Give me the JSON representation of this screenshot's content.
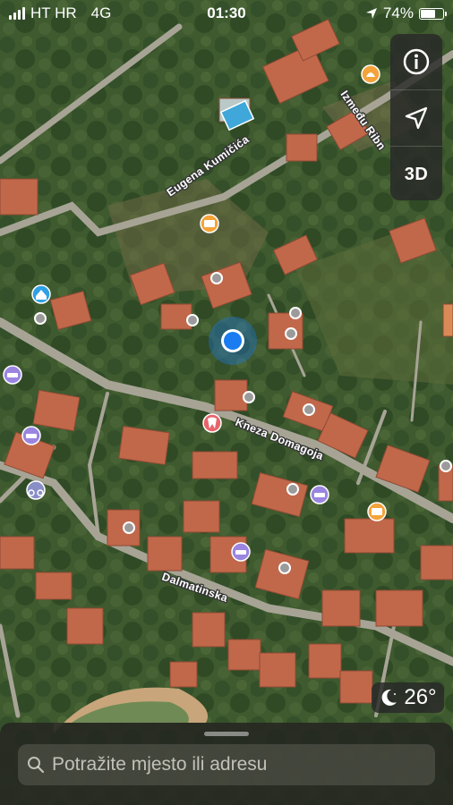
{
  "status_bar": {
    "carrier": "HT HR",
    "network": "4G",
    "time": "01:30",
    "battery": "74%",
    "battery_level": 0.74
  },
  "map": {
    "streets": [
      "Eugena Kumičića",
      "Između Ribn",
      "Kneza Domagoja",
      "Dalmatinska"
    ],
    "colors": {
      "vegetation": "#3e5a2e",
      "roof": "#c1684a",
      "road": "#a7a496",
      "user_location": "#1a7cf0"
    },
    "poi_icons": [
      "restaurant-icon",
      "hotel-icon",
      "home-icon",
      "dentist-icon",
      "motorcycle-icon",
      "bed-icon"
    ]
  },
  "controls": {
    "info_icon": "info-icon",
    "location_icon": "location-arrow-icon",
    "mode_3d": "3D"
  },
  "weather": {
    "icon": "moon-icon",
    "temperature": "26°"
  },
  "search": {
    "placeholder": "Potražite mjesto ili adresu"
  }
}
